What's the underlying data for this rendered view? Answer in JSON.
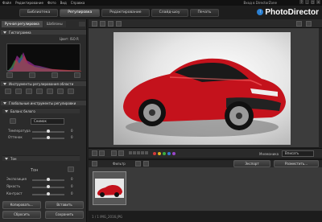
{
  "menubar": {
    "items": [
      "Файл",
      "Редактирование",
      "Фото",
      "Вид",
      "Справка"
    ],
    "right_link": "Вход в DirectorZone"
  },
  "app": {
    "logo_text": "PhotoDirector",
    "logo_badge": "↑",
    "accent": "#2a7fd1"
  },
  "window_controls": [
    "?",
    "_",
    "□",
    "×"
  ],
  "module_tabs": [
    {
      "label": "Библиотека",
      "active": false
    },
    {
      "label": "Регулировка",
      "active": true
    },
    {
      "label": "Редактирование",
      "active": false
    },
    {
      "label": "Слайд-шоу",
      "active": false
    },
    {
      "label": "Печать",
      "active": false
    }
  ],
  "left_tabs": {
    "manual": "Ручная регулировка",
    "presets": "Шаблоны"
  },
  "histogram": {
    "title": "Гистограмма",
    "info": "Цвет:  ISO  R"
  },
  "sections": {
    "tools": "Инструменты регулирования области",
    "global": "Глобальные инструменты регулировки",
    "wb": "Баланс белого",
    "tone": "Тон"
  },
  "wb": {
    "preset_label": "Снимок",
    "temp_label": "Температура",
    "tint_label": "Оттенок",
    "temp_value": "0",
    "tint_value": "0"
  },
  "tone": {
    "exposure_label": "Экспозиция",
    "brightness_label": "Яркость",
    "contrast_label": "Контраст",
    "values": [
      "0",
      "0",
      "0"
    ]
  },
  "left_buttons": {
    "copy": "Копировать...",
    "paste": "Вставить",
    "reset": "Сбросить",
    "save": "Сохранить"
  },
  "viewer_bottom": {
    "view_label": "Мнемоника",
    "fit_label": "Вписать",
    "colors": [
      "#d23a3a",
      "#e0b020",
      "#3fae3f",
      "#2f7ad4",
      "#9a47c9"
    ]
  },
  "film_toolbar": {
    "filter_label": "Фильтр",
    "export_label": "Экспорт",
    "share_label": "Разместить..."
  },
  "status": {
    "text": "1 / 1   IMG_2016.JPG"
  }
}
